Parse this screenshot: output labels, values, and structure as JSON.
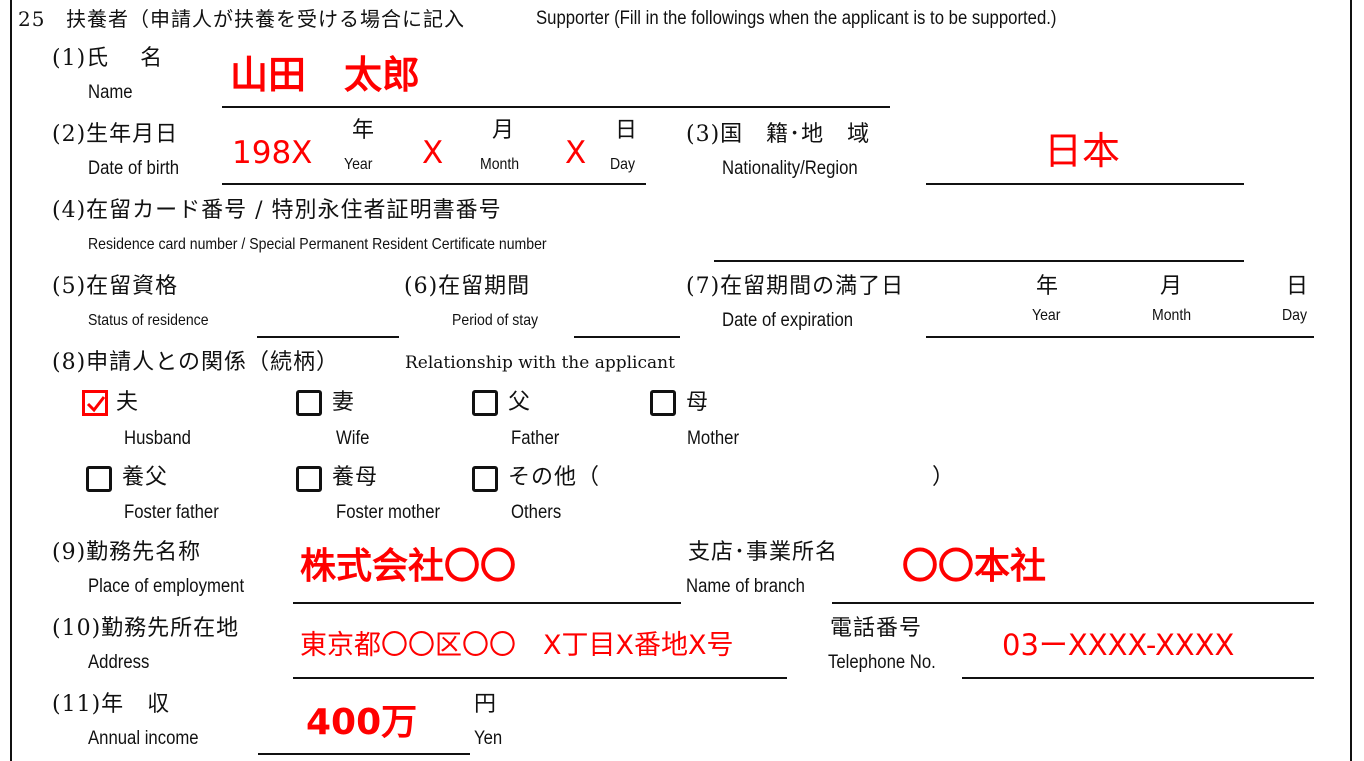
{
  "section": {
    "number": "25",
    "title_jp": "扶養者（申請人が扶養を受ける場合に記入",
    "title_en": "Supporter (Fill in the followings when the applicant is to be supported.)"
  },
  "fields": {
    "name": {
      "label_jp": "(1)氏　 名",
      "label_en": "Name",
      "value": "山田　太郎"
    },
    "dob": {
      "label_jp": "(2)生年月日",
      "label_en": "Date of birth",
      "year_value": "198X",
      "month_value": "X",
      "day_value": "X",
      "year_jp": "年",
      "year_en": "Year",
      "month_jp": "月",
      "month_en": "Month",
      "day_jp": "日",
      "day_en": "Day"
    },
    "nationality": {
      "label_jp": "(3)国　籍･地　域",
      "label_en": "Nationality/Region",
      "value": "日本"
    },
    "residence_card": {
      "label_jp": "(4)在留カード番号 / 特別永住者証明書番号",
      "label_en": "Residence card number / Special Permanent Resident Certificate number",
      "value": ""
    },
    "status": {
      "label_jp": "(5)在留資格",
      "label_en": "Status of residence",
      "value": ""
    },
    "period": {
      "label_jp": "(6)在留期間",
      "label_en": "Period of stay",
      "value": ""
    },
    "expiration": {
      "label_jp": "(7)在留期間の満了日",
      "label_en": "Date of expiration",
      "year_jp": "年",
      "year_en": "Year",
      "month_jp": "月",
      "month_en": "Month",
      "day_jp": "日",
      "day_en": "Day"
    },
    "relationship": {
      "label_jp": "(8)申請人との関係（続柄）",
      "label_en": "Relationship with the applicant",
      "options": [
        {
          "jp": "夫",
          "en": "Husband",
          "checked": true
        },
        {
          "jp": "妻",
          "en": "Wife",
          "checked": false
        },
        {
          "jp": "父",
          "en": "Father",
          "checked": false
        },
        {
          "jp": "母",
          "en": "Mother",
          "checked": false
        },
        {
          "jp": "養父",
          "en": "Foster father",
          "checked": false
        },
        {
          "jp": "養母",
          "en": "Foster mother",
          "checked": false
        },
        {
          "jp": "その他（",
          "en": "Others",
          "checked": false
        }
      ],
      "others_close": "）",
      "others_value": ""
    },
    "employer": {
      "label_jp": "(9)勤務先名称",
      "label_en": "Place of employment",
      "value": "株式会社〇〇"
    },
    "branch": {
      "label_jp": "支店･事業所名",
      "label_en": "Name of branch",
      "value": "〇〇本社"
    },
    "address": {
      "label_jp": "(10)勤務先所在地",
      "label_en": "Address",
      "value": "東京都〇〇区〇〇　X丁目X番地X号"
    },
    "phone": {
      "label_jp": "電話番号",
      "label_en": "Telephone No.",
      "value": "03ーXXXX-XXXX"
    },
    "income": {
      "label_jp": "(11)年　収",
      "label_en": "Annual income",
      "value": "400万",
      "unit_jp": "円",
      "unit_en": "Yen"
    }
  },
  "colors": {
    "fill_ink": "#ff0000",
    "form_ink": "#111111"
  }
}
